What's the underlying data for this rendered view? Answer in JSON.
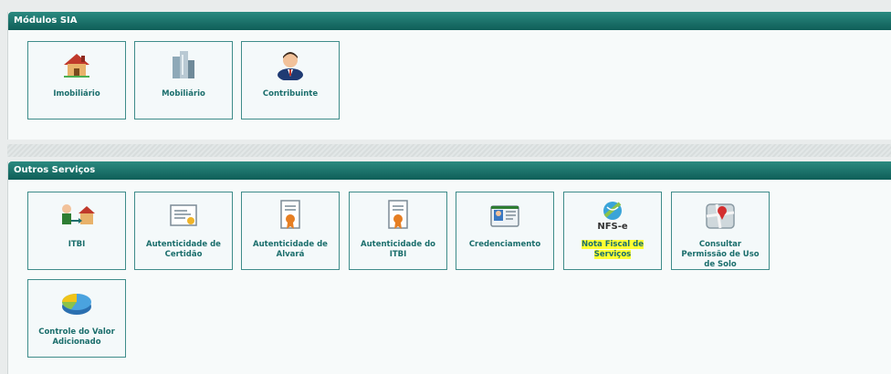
{
  "modules": {
    "title": "Módulos SIA",
    "tiles": [
      {
        "label": "Imobiliário",
        "icon": "house-icon"
      },
      {
        "label": "Mobiliário",
        "icon": "buildings-icon"
      },
      {
        "label": "Contribuinte",
        "icon": "person-icon"
      }
    ]
  },
  "services": {
    "title": "Outros Serviços",
    "tiles": [
      {
        "label": "ITBI",
        "icon": "property-transfer-icon"
      },
      {
        "label": "Autenticidade de Certidão",
        "icon": "certificate-icon"
      },
      {
        "label": "Autenticidade de Alvará",
        "icon": "license-document-icon"
      },
      {
        "label": "Autenticidade do ITBI",
        "icon": "itbi-document-icon"
      },
      {
        "label": "Credenciamento",
        "icon": "id-card-icon"
      },
      {
        "label": "Nota Fiscal de Serviços",
        "icon": "nfse-icon",
        "badge": "NFS-e",
        "highlighted": true
      },
      {
        "label": "Consultar Permissão de Uso de Solo",
        "icon": "map-pin-icon"
      },
      {
        "label": "Controle do Valor Adicionado",
        "icon": "pie-chart-icon"
      }
    ]
  },
  "colors": {
    "header": "#136660",
    "tile_border": "#3e8c8a",
    "label": "#1b6e6c",
    "highlight": "#ffff33"
  }
}
